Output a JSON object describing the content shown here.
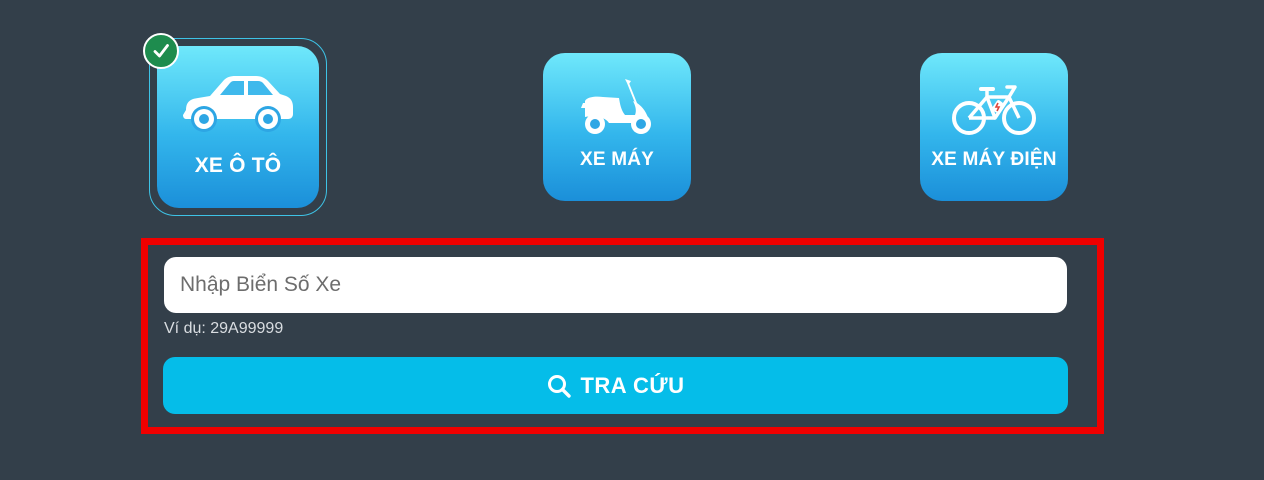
{
  "colors": {
    "page_background": "#333f4a",
    "card_gradient_top": "#6fe8fb",
    "card_gradient_bottom": "#1b8fd9",
    "selected_check": "#1e8c4e",
    "search_button": "#05bde9",
    "highlight_border": "#f00000"
  },
  "vehicle_types": [
    {
      "label": "XE Ô TÔ",
      "icon": "car-icon",
      "selected": true
    },
    {
      "label": "XE MÁY",
      "icon": "scooter-icon",
      "selected": false
    },
    {
      "label": "XE MÁY ĐIỆN",
      "icon": "electric-bicycle-icon",
      "selected": false
    }
  ],
  "selected_indicator_icon": "check-icon",
  "search": {
    "placeholder": "Nhập Biển Số Xe",
    "value": "",
    "example": "Ví dụ: 29A99999",
    "button_label": "TRA CỨU",
    "button_icon": "search-icon"
  }
}
